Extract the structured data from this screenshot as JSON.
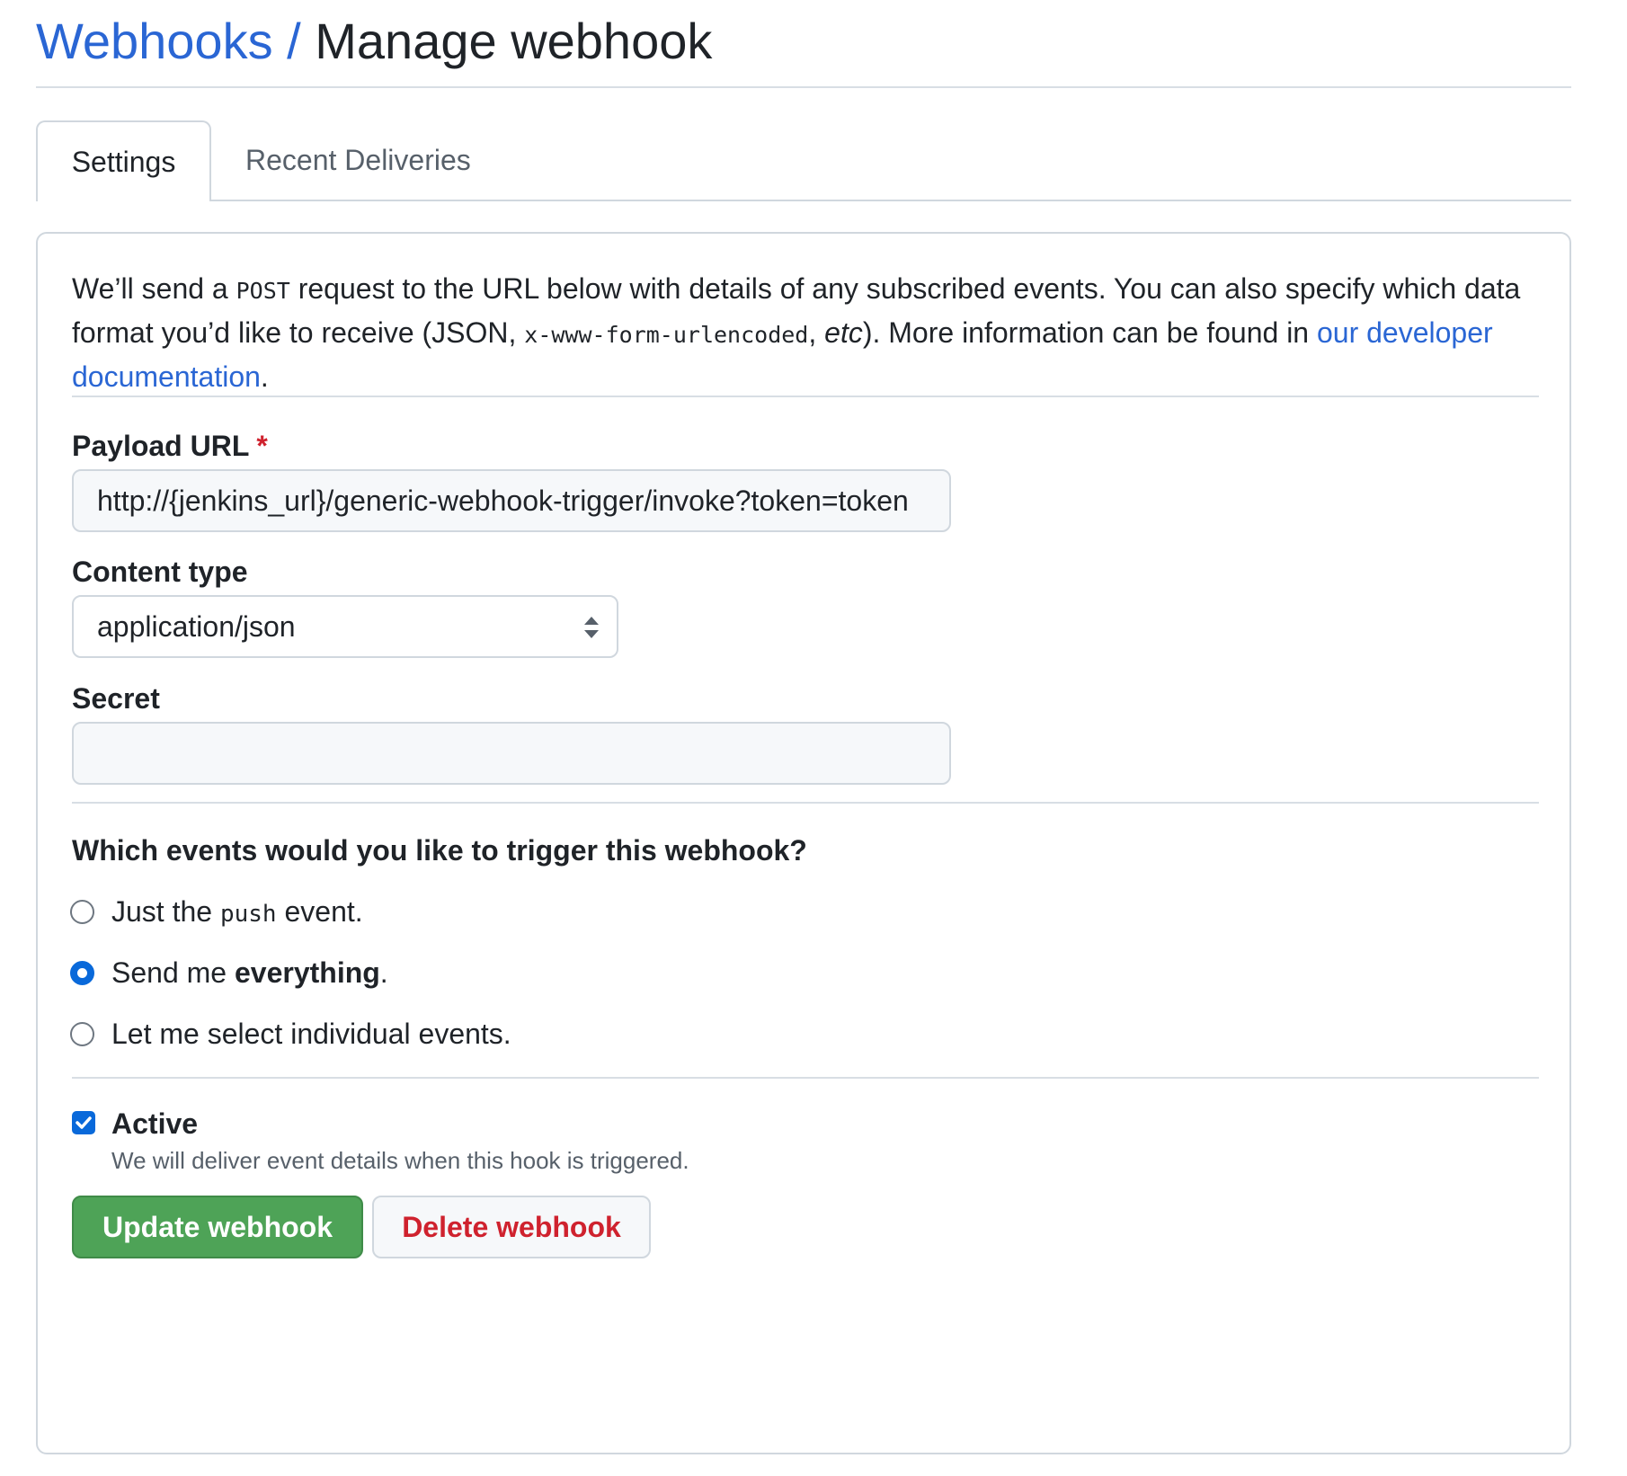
{
  "header": {
    "breadcrumb_link": "Webhooks",
    "separator": "/",
    "current_page": "Manage webhook"
  },
  "tabs": [
    {
      "label": "Settings",
      "active": true
    },
    {
      "label": "Recent Deliveries",
      "active": false
    }
  ],
  "intro": {
    "part1": "We’ll send a ",
    "code_post": "POST",
    "part2": " request to the URL below with details of any subscribed events. You can also specify which data format you’d like to receive (JSON, ",
    "code_format": "x-www-form-urlencoded",
    "part3": ", ",
    "etc": "etc",
    "part4": "). More information can be found in ",
    "link": "our developer documentation",
    "part5": "."
  },
  "payload_url": {
    "label": "Payload URL",
    "required_mark": "*",
    "value": "http://{jenkins_url}/generic-webhook-trigger/invoke?token=token"
  },
  "content_type": {
    "label": "Content type",
    "selected": "application/json"
  },
  "secret": {
    "label": "Secret",
    "value": ""
  },
  "events": {
    "question": "Which events would you like to trigger this webhook?",
    "options": [
      {
        "prefix": "Just the ",
        "code": "push",
        "suffix": " event.",
        "checked": false
      },
      {
        "prefix": "Send me ",
        "bold": "everything",
        "suffix": ".",
        "checked": true
      },
      {
        "prefix": "Let me select individual events.",
        "checked": false
      }
    ]
  },
  "active": {
    "label": "Active",
    "checked": true,
    "description": "We will deliver event details when this hook is triggered."
  },
  "buttons": {
    "update": "Update webhook",
    "delete": "Delete webhook"
  },
  "colors": {
    "link": "#2a66d4",
    "primary_button": "#4ea357",
    "danger_text": "#cf222e",
    "checked_accent": "#0969da"
  }
}
